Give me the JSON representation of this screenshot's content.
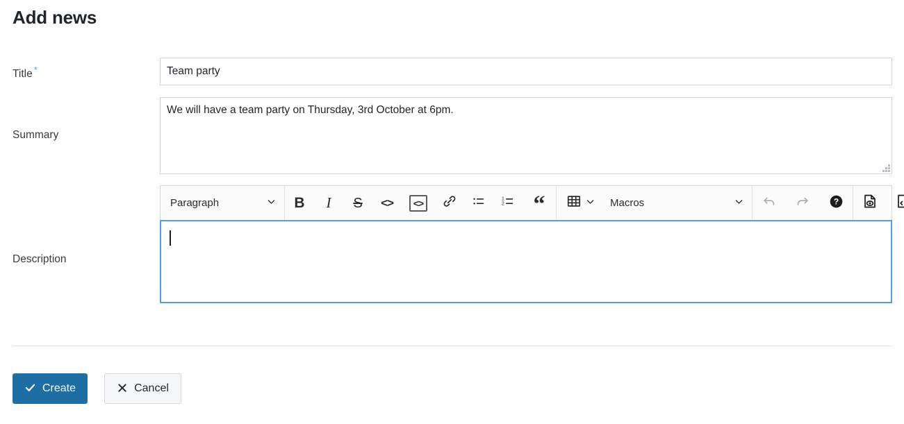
{
  "page": {
    "title": "Add news"
  },
  "form": {
    "title_row": {
      "label": "Title",
      "required_marker": "*",
      "value": "Team party",
      "placeholder": ""
    },
    "summary_row": {
      "label": "Summary",
      "value": "We will have a team party on Thursday, 3rd October at 6pm.",
      "placeholder": ""
    },
    "description_row": {
      "label": "Description",
      "value": "",
      "placeholder": ""
    }
  },
  "editor": {
    "style_select": {
      "name": "paragraph-style-select",
      "value": "Paragraph",
      "chevron": "chevron-down-icon"
    },
    "macros_select": {
      "name": "macros-select",
      "value": "Macros",
      "chevron": "chevron-down-icon"
    },
    "buttons": {
      "bold": {
        "label": "B",
        "icon": "bold-icon"
      },
      "italic": {
        "label": "I",
        "icon": "italic-icon"
      },
      "strikethrough": {
        "label": "S",
        "icon": "strikethrough-icon"
      },
      "inline_code": {
        "label": "<>",
        "icon": "inline-code-icon"
      },
      "code_block": {
        "label": "<>",
        "icon": "code-block-icon"
      },
      "link": {
        "icon": "link-icon"
      },
      "bulleted_list": {
        "icon": "bulleted-list-icon"
      },
      "numbered_list": {
        "icon": "numbered-list-icon",
        "marker_one": "1",
        "marker_two": "2"
      },
      "blockquote": {
        "label": "“",
        "icon": "blockquote-icon"
      },
      "table": {
        "icon": "table-icon"
      },
      "undo": {
        "icon": "undo-icon",
        "disabled": true
      },
      "redo": {
        "icon": "redo-icon",
        "disabled": true
      },
      "help": {
        "icon": "help-icon"
      },
      "preview": {
        "icon": "preview-document-icon"
      },
      "source": {
        "icon": "source-code-document-icon"
      }
    }
  },
  "actions": {
    "create": {
      "label": "Create",
      "icon": "checkmark-icon"
    },
    "cancel": {
      "label": "Cancel",
      "icon": "close-x-icon"
    }
  },
  "colors": {
    "primary_button": "#1c6ea4",
    "focus_border": "#4ea0e4",
    "required_star": "#5b9bd5",
    "field_border": "#ced4da",
    "toolbar_background": "#fbfbfb"
  }
}
